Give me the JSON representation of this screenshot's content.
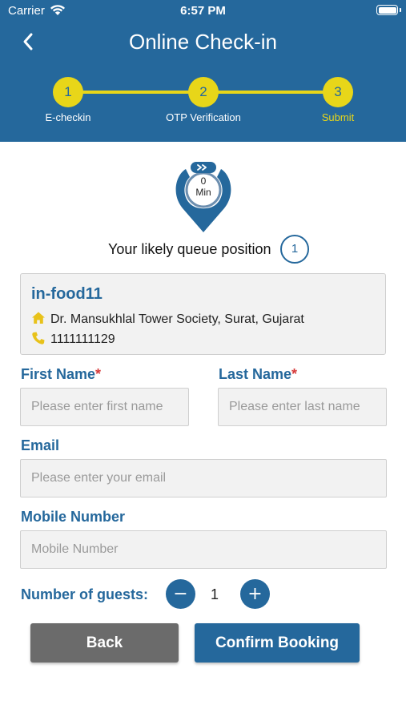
{
  "status_bar": {
    "carrier": "Carrier",
    "time": "6:57 PM"
  },
  "header": {
    "title": "Online Check-in"
  },
  "stepper": {
    "steps": [
      {
        "number": "1",
        "label": "E-checkin"
      },
      {
        "number": "2",
        "label": "OTP Verification"
      },
      {
        "number": "3",
        "label": "Submit"
      }
    ],
    "active_step": 3
  },
  "wait": {
    "value": "0",
    "unit": "Min"
  },
  "queue": {
    "label": "Your likely queue position",
    "position": "1"
  },
  "restaurant": {
    "name": "in-food11",
    "address": "Dr. Mansukhlal Tower Society,  Surat, Gujarat",
    "phone": "1111111129"
  },
  "form": {
    "first_name": {
      "label": "First Name",
      "required_mark": "*",
      "placeholder": "Please enter first name"
    },
    "last_name": {
      "label": "Last Name",
      "required_mark": "*",
      "placeholder": "Please enter last name"
    },
    "email": {
      "label": "Email",
      "placeholder": "Please enter your email"
    },
    "mobile": {
      "label": "Mobile Number",
      "placeholder": "Mobile Number"
    },
    "guests": {
      "label": "Number of guests:",
      "minus": "−",
      "count": "1",
      "plus": "+"
    }
  },
  "actions": {
    "back_label": "Back",
    "confirm_label": "Confirm Booking"
  },
  "colors": {
    "primary": "#25689c",
    "accent": "#e8d619",
    "required": "#d63b3b",
    "back_button": "#6b6b6b"
  }
}
